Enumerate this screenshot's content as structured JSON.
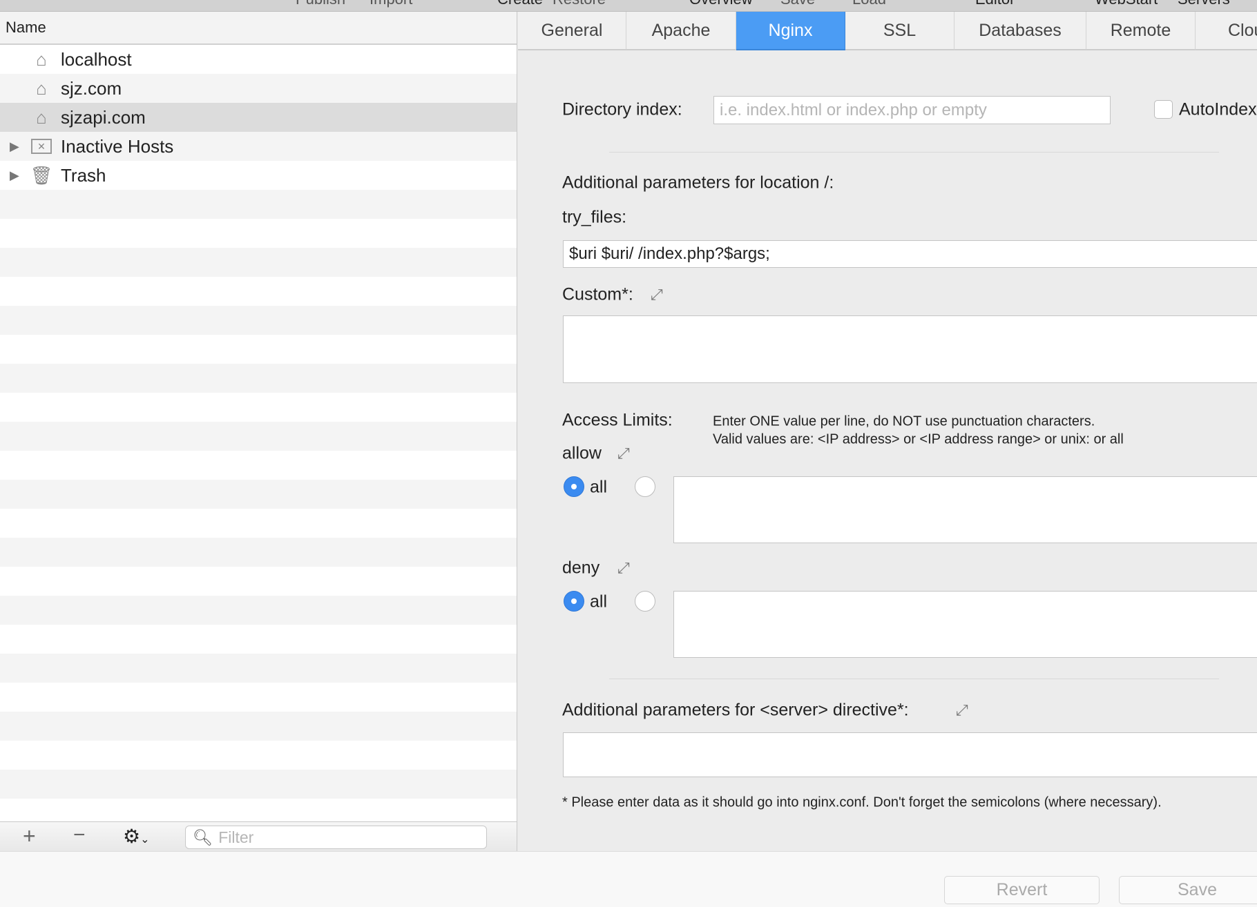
{
  "toolbar": {
    "items": [
      "Publish",
      "Import",
      "Create",
      "Restore",
      "Overview",
      "Save",
      "Load",
      "Editor",
      "WebStart",
      "Servers"
    ]
  },
  "sidebar": {
    "header": "Name",
    "items": [
      {
        "label": "localhost",
        "icon": "house-icon"
      },
      {
        "label": "sjz.com",
        "icon": "house-icon"
      },
      {
        "label": "sjzapi.com",
        "icon": "house-icon",
        "selected": true
      },
      {
        "label": "Inactive Hosts",
        "icon": "inactive-folder-icon",
        "expandable": true
      },
      {
        "label": "Trash",
        "icon": "trash-icon",
        "expandable": true
      }
    ],
    "filter_placeholder": "Filter"
  },
  "tabs": [
    "General",
    "Apache",
    "Nginx",
    "SSL",
    "Databases",
    "Remote",
    "Clou"
  ],
  "active_tab": "Nginx",
  "accent_color": "#4b9cf4",
  "form": {
    "directory_index_label": "Directory index:",
    "directory_index_placeholder": "i.e. index.html or index.php or empty",
    "autoindex_label": "AutoIndex",
    "autoindex_checked": false,
    "location_label": "Additional parameters for location /:",
    "try_files_label": "try_files:",
    "try_files_value": "$uri $uri/ /index.php?$args;",
    "custom_label": "Custom*:",
    "access_limits_label": "Access Limits:",
    "access_help_1": "Enter ONE value per line, do NOT use punctuation characters.",
    "access_help_2": "Valid values are: <IP address> or <IP address range> or unix: or all",
    "allow_label": "allow",
    "allow_all_label": "all",
    "deny_label": "deny",
    "deny_all_label": "all",
    "server_label": "Additional parameters for <server> directive*:",
    "note": "* Please enter data as it should go into nginx.conf. Don't forget the semicolons (where necessary)."
  },
  "buttons": {
    "revert": "Revert",
    "save": "Save"
  }
}
